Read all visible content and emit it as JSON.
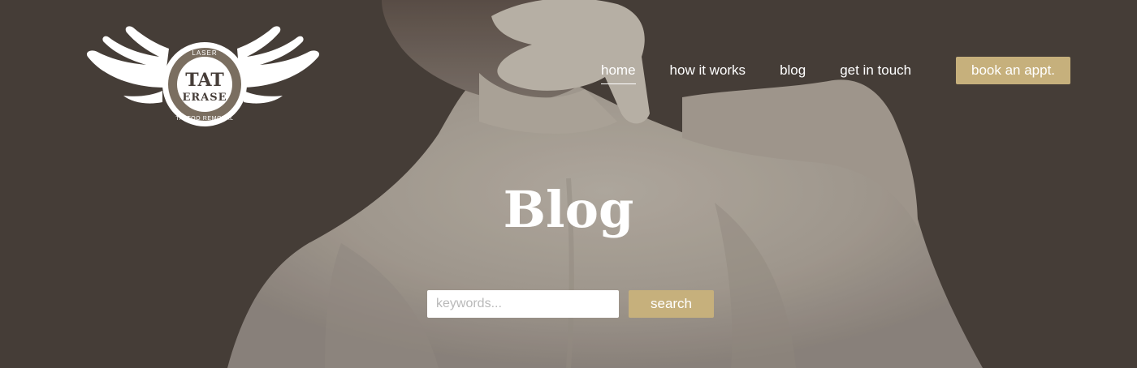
{
  "logo": {
    "top_text": "LASER",
    "main_line1": "TAT",
    "main_line2": "ERASE",
    "bottom_text": "TATTOO REMOVAL"
  },
  "nav": {
    "items": [
      {
        "label": "home",
        "active": true
      },
      {
        "label": "how it works"
      },
      {
        "label": "blog"
      },
      {
        "label": "get in touch"
      }
    ],
    "cta_label": "book an appt."
  },
  "hero": {
    "title": "Blog"
  },
  "search": {
    "placeholder": "keywords...",
    "button_label": "search"
  },
  "colors": {
    "background": "#463d38",
    "accent": "#c6b07c",
    "photo_tone": "#a89f95"
  }
}
